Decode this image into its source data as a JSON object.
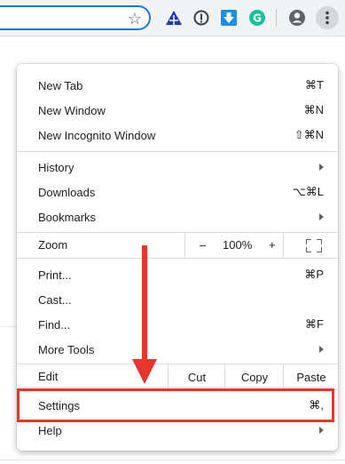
{
  "toolbar": {
    "bookmark_icon": "star-icon",
    "extensions": [
      "triangle-extension-icon",
      "info-extension-icon",
      "download-extension-icon",
      "grammarly-icon"
    ],
    "profile_icon": "profile-icon",
    "menu_icon": "kebab-menu-icon"
  },
  "menu": {
    "new_tab": {
      "label": "New Tab",
      "shortcut": "⌘T"
    },
    "new_window": {
      "label": "New Window",
      "shortcut": "⌘N"
    },
    "new_incognito": {
      "label": "New Incognito Window",
      "shortcut": "⇧⌘N"
    },
    "history": {
      "label": "History"
    },
    "downloads": {
      "label": "Downloads",
      "shortcut": "⌥⌘L"
    },
    "bookmarks": {
      "label": "Bookmarks"
    },
    "zoom": {
      "label": "Zoom",
      "minus": "–",
      "level": "100%",
      "plus": "+"
    },
    "print": {
      "label": "Print...",
      "shortcut": "⌘P"
    },
    "cast": {
      "label": "Cast..."
    },
    "find": {
      "label": "Find...",
      "shortcut": "⌘F"
    },
    "more_tools": {
      "label": "More Tools"
    },
    "edit": {
      "label": "Edit",
      "cut": "Cut",
      "copy": "Copy",
      "paste": "Paste"
    },
    "settings": {
      "label": "Settings",
      "shortcut": "⌘,"
    },
    "help": {
      "label": "Help"
    }
  },
  "annotation": {
    "color": "#e8352b"
  }
}
